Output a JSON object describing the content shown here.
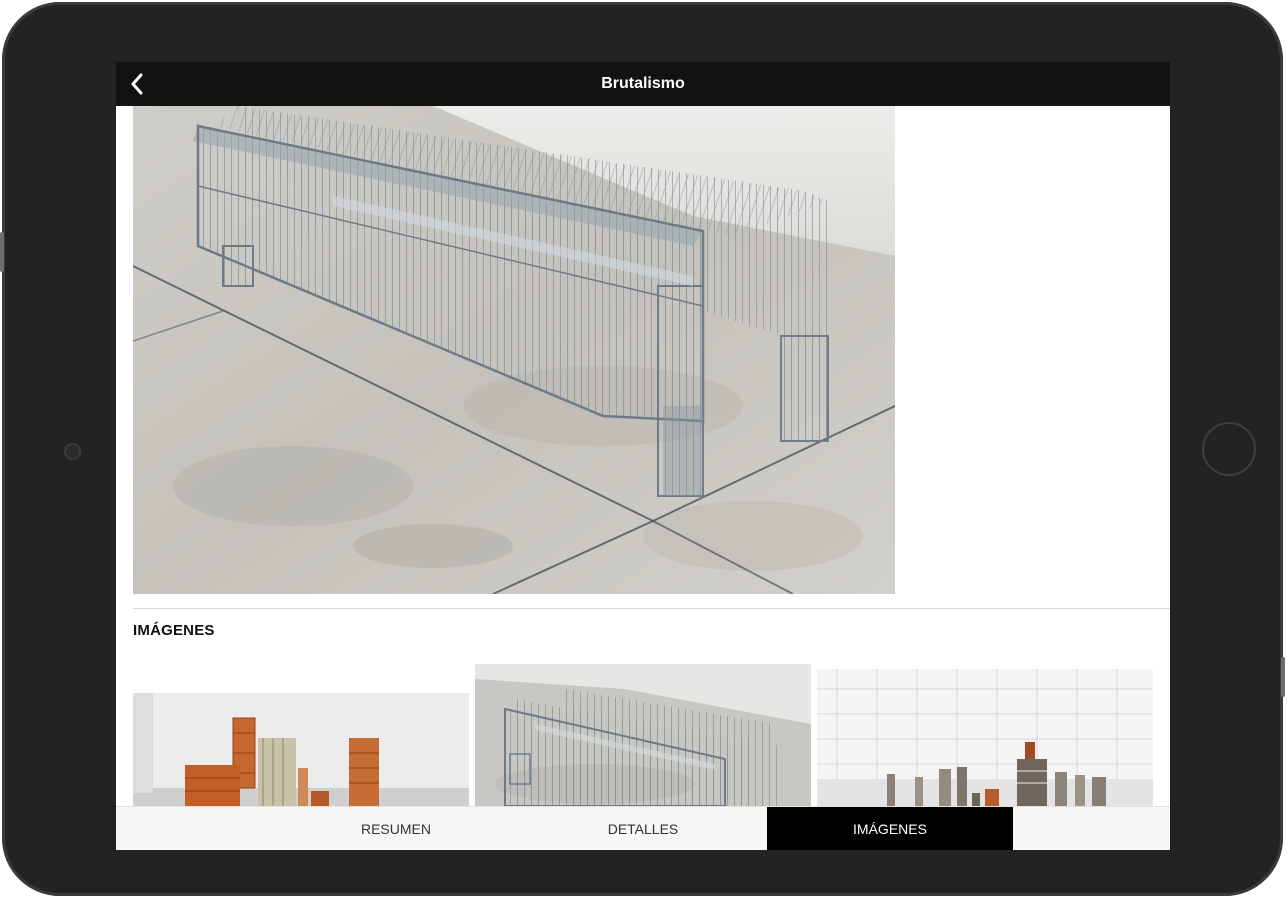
{
  "header": {
    "title": "Brutalismo",
    "back_icon": "chevron-left-icon"
  },
  "gallery": {
    "section_title": "IMÁGENES",
    "thumbnails": [
      {
        "name": "thumbnail-orange-shelves"
      },
      {
        "name": "thumbnail-wire-benches"
      },
      {
        "name": "thumbnail-white-hall"
      }
    ]
  },
  "tabs": [
    {
      "label": "RESUMEN",
      "active": false
    },
    {
      "label": "DETALLES",
      "active": false
    },
    {
      "label": "IMÁGENES",
      "active": true
    }
  ],
  "colors": {
    "navbar": "#121212",
    "active_tab": "#000000",
    "tab_bar": "#f7f7f7",
    "device_frame": "#232323"
  }
}
